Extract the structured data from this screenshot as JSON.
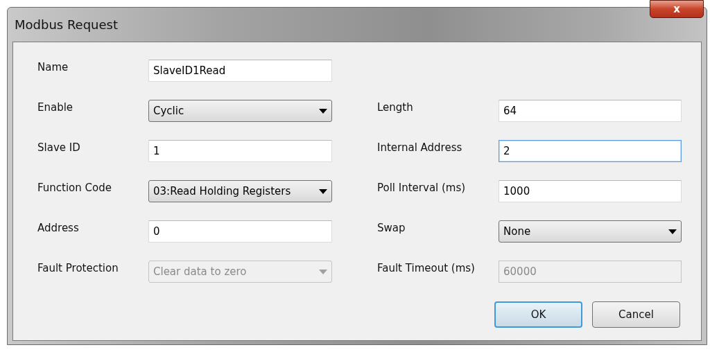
{
  "window": {
    "title": "Modbus Request",
    "close_label": "x"
  },
  "rows": [
    {
      "left": {
        "label": "Name",
        "value": "SlaveID1Read",
        "kind": "text",
        "disabled": false,
        "focused": false
      }
    },
    {
      "left": {
        "label": "Enable",
        "value": "Cyclic",
        "kind": "dropdown",
        "disabled": false,
        "focused": false
      },
      "right": {
        "label": "Length",
        "value": "64",
        "kind": "text",
        "disabled": false,
        "focused": false
      }
    },
    {
      "left": {
        "label": "Slave ID",
        "value": "1",
        "kind": "text",
        "disabled": false,
        "focused": false
      },
      "right": {
        "label": "Internal Address",
        "value": "2",
        "kind": "text",
        "disabled": false,
        "focused": true
      }
    },
    {
      "left": {
        "label": "Function Code",
        "value": "03:Read Holding Registers",
        "kind": "dropdown",
        "disabled": false,
        "focused": false
      },
      "right": {
        "label": "Poll Interval (ms)",
        "value": "1000",
        "kind": "text",
        "disabled": false,
        "focused": false
      }
    },
    {
      "left": {
        "label": "Address",
        "value": "0",
        "kind": "text",
        "disabled": false,
        "focused": false
      },
      "right": {
        "label": "Swap",
        "value": "None",
        "kind": "dropdown",
        "disabled": false,
        "focused": false
      }
    },
    {
      "left": {
        "label": "Fault Protection",
        "value": "Clear data to zero",
        "kind": "dropdown",
        "disabled": true,
        "focused": false
      },
      "right": {
        "label": "Fault Timeout (ms)",
        "value": "60000",
        "kind": "text",
        "disabled": true,
        "focused": false
      }
    }
  ],
  "buttons": [
    {
      "label": "OK",
      "default": true
    },
    {
      "label": "Cancel",
      "default": false
    }
  ]
}
